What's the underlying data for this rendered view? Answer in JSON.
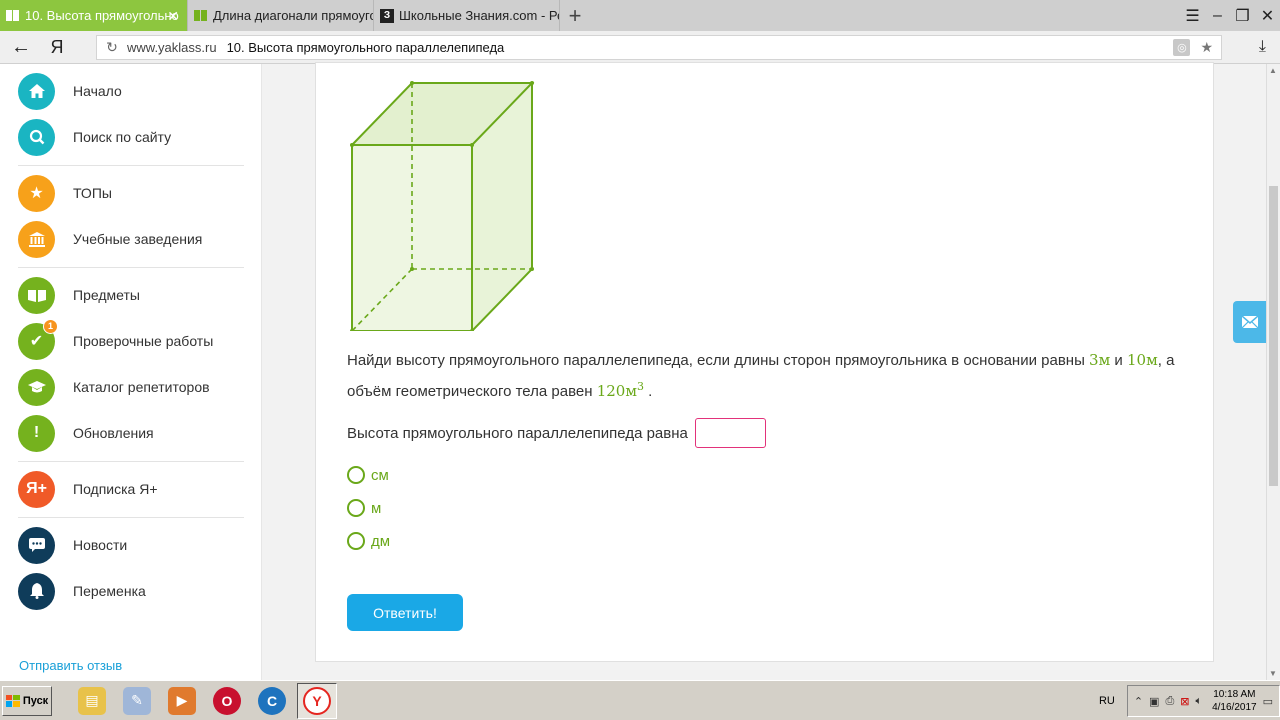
{
  "browser": {
    "tabs": [
      {
        "title": "10. Высота прямоугольно",
        "active": true
      },
      {
        "title": "Длина диагонали прямоуго",
        "active": false
      },
      {
        "title": "Школьные Знания.com - Ре",
        "active": false
      }
    ],
    "new_tab": "+",
    "host": "www.yaklass.ru",
    "page_title": "10. Высота прямоугольного параллелепипеда",
    "logo": "Я"
  },
  "sidebar": {
    "items": [
      {
        "label": "Начало",
        "icon": "home-icon",
        "color": "#1ab5c2"
      },
      {
        "label": "Поиск по сайту",
        "icon": "search-icon",
        "color": "#1ab5c2"
      },
      {
        "label": "ТОПы",
        "icon": "star-icon",
        "color": "#f7a11a"
      },
      {
        "label": "Учебные заведения",
        "icon": "institution-icon",
        "color": "#f7a11a"
      },
      {
        "label": "Предметы",
        "icon": "book-icon",
        "color": "#75b21e"
      },
      {
        "label": "Проверочные работы",
        "icon": "check-icon",
        "color": "#75b21e",
        "badge": "1"
      },
      {
        "label": "Каталог репетиторов",
        "icon": "graduation-cap-icon",
        "color": "#75b21e"
      },
      {
        "label": "Обновления",
        "icon": "exclamation-icon",
        "color": "#75b21e"
      },
      {
        "label": "Подписка Я+",
        "icon": "ya-plus-icon",
        "color": "#f05a28",
        "icon_text": "Я+"
      },
      {
        "label": "Новости",
        "icon": "chat-icon",
        "color": "#0f3c5a"
      },
      {
        "label": "Переменка",
        "icon": "bell-icon",
        "color": "#0f3c5a"
      }
    ],
    "feedback_link": "Отправить отзыв"
  },
  "task": {
    "question_part1": "Найди высоту прямоугольного параллелепипеда, если длины сторон прямоугольника в основании равны",
    "value_a": "3м",
    "and": "и",
    "value_b": "10м",
    "question_part2": ", а объём геометрического тела равен",
    "volume": "120м",
    "volume_exp": "3",
    "period": ".",
    "answer_prompt": "Высота прямоугольного параллелепипеда равна",
    "answer_value": "",
    "units": [
      "см",
      "м",
      "дм"
    ],
    "submit_label": "Ответить!"
  },
  "taskbar": {
    "start_label": "Пуск",
    "lang": "RU",
    "time": "10:18 AM",
    "date": "4/16/2017"
  }
}
